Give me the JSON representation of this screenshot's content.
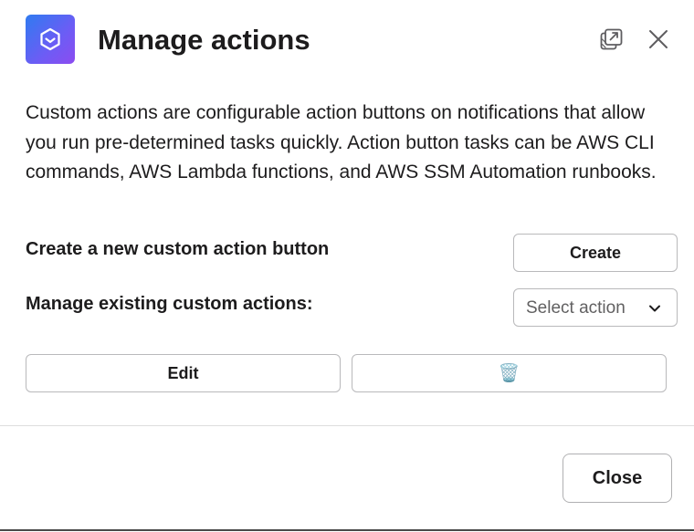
{
  "modal": {
    "title": "Manage actions",
    "app_icon": "aws-chatbot-icon",
    "header_icons": [
      "popout-icon",
      "close-icon"
    ],
    "description": "Custom actions are configurable action buttons on notifications that allow you run pre-determined tasks quickly.  Action button tasks can be AWS CLI commands, AWS Lambda functions, and AWS SSM Automation runbooks.",
    "create_row": {
      "label": "Create a new custom action button",
      "button_label": "Create"
    },
    "manage_row": {
      "label": "Manage existing custom actions:",
      "select_placeholder": "Select action"
    },
    "actions": {
      "edit_label": "Edit",
      "delete_icon": "🗑️"
    },
    "footer": {
      "close_label": "Close"
    }
  }
}
